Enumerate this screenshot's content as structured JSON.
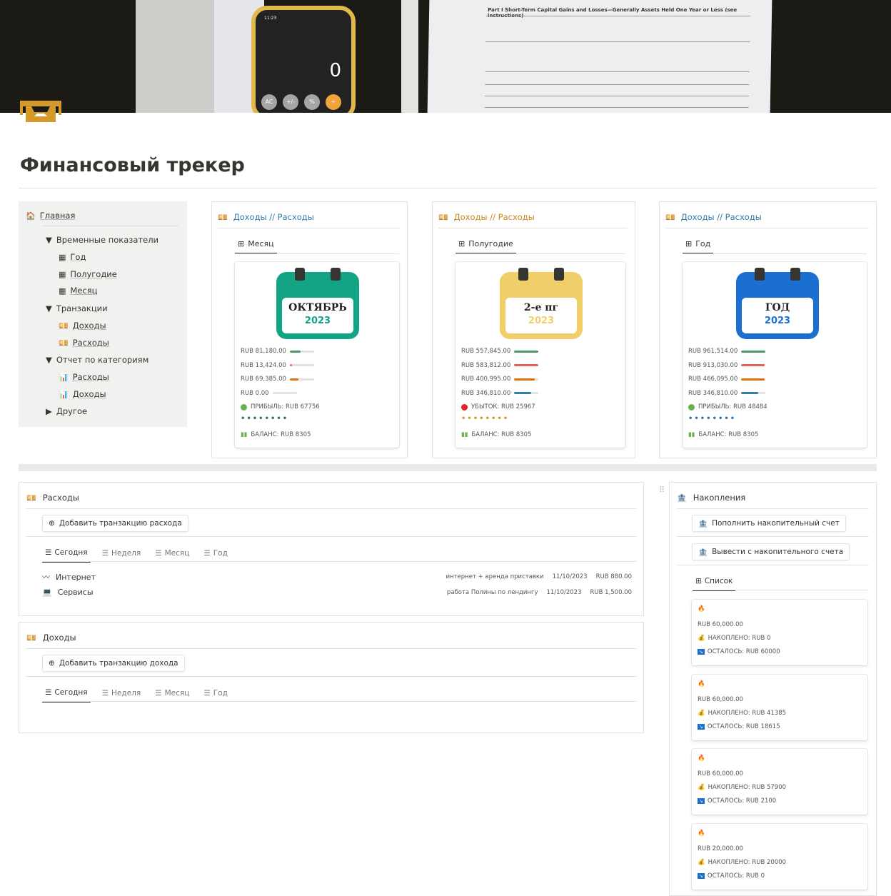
{
  "cover": {
    "form_title": "Part I  Short-Term Capital Gains and Losses—Generally Assets Held One Year or Less (see instructions)",
    "phone_time": "11:23",
    "phone_display": "0",
    "calc_keys": [
      "AC",
      "+/-",
      "%",
      "÷"
    ]
  },
  "page": {
    "title": "Финансовый трекер"
  },
  "sidebar": {
    "home": "Главная",
    "groups": [
      {
        "label": "Временные показатели",
        "expanded": true,
        "items": [
          "Год",
          "Полугодие",
          "Месяц"
        ]
      },
      {
        "label": "Транзакции",
        "expanded": true,
        "items": [
          "Доходы",
          "Расходы"
        ]
      },
      {
        "label": "Отчет по категориям",
        "expanded": true,
        "items": [
          "Расходы",
          "Доходы"
        ]
      },
      {
        "label": "Другое",
        "expanded": false,
        "items": []
      }
    ]
  },
  "cards": [
    {
      "header": "Доходы // Расходы",
      "tab": "Месяц",
      "cal_color": "#13a385",
      "cal_title": "ОКТЯБРЬ",
      "cal_year": "2023",
      "stats": [
        {
          "value": "RUB 81,180.00",
          "fill": 0.45,
          "color": "#4f9768"
        },
        {
          "value": "RUB 13,424.00",
          "fill": 0.08,
          "color": "#e16259"
        },
        {
          "value": "RUB 69,385.00",
          "fill": 0.35,
          "color": "#d9730d"
        },
        {
          "value": "RUB 0.00",
          "fill": 0,
          "color": "#337ea9"
        }
      ],
      "result": "ПРИБЫЛЬ: RUB 67756",
      "result_color": "#6aaf50",
      "dots_color": "#2f6f6b",
      "balance": "БАЛАНС: RUB 8305"
    },
    {
      "header": "Доходы // Расходы",
      "tab": "Полугодие",
      "cal_color": "#f0cf6a",
      "cal_title": "2-е пг",
      "cal_year": "2023",
      "header_color": "#c98a1b",
      "stats": [
        {
          "value": "RUB 557,845.00",
          "fill": 1,
          "color": "#4f9768"
        },
        {
          "value": "RUB 583,812.00",
          "fill": 1,
          "color": "#e16259"
        },
        {
          "value": "RUB 400,995.00",
          "fill": 0.85,
          "color": "#d9730d"
        },
        {
          "value": "RUB 346,810.00",
          "fill": 0.7,
          "color": "#337ea9"
        }
      ],
      "result": "УБЫТОК: RUB 25967",
      "result_color": "#e0232e",
      "dots_color": "#d39a2a",
      "balance": "БАЛАНС: RUB 8305"
    },
    {
      "header": "Доходы // Расходы",
      "tab": "Год",
      "cal_color": "#1b6fd0",
      "cal_title": "ГОД",
      "cal_year": "2023",
      "header_color": "#337ea9",
      "stats": [
        {
          "value": "RUB 961,514.00",
          "fill": 1,
          "color": "#4f9768"
        },
        {
          "value": "RUB 913,030.00",
          "fill": 0.95,
          "color": "#e16259"
        },
        {
          "value": "RUB 466,095.00",
          "fill": 0.95,
          "color": "#d9730d"
        },
        {
          "value": "RUB 346,810.00",
          "fill": 0.7,
          "color": "#337ea9"
        }
      ],
      "result": "ПРИБЫЛЬ: RUB 48484",
      "result_color": "#6aaf50",
      "dots_color": "#2a72b5",
      "balance": "БАЛАНС: RUB 8305"
    }
  ],
  "expenses": {
    "title": "Расходы",
    "add_button": "Добавить транзакцию расхода",
    "tabs": [
      "Сегодня",
      "Неделя",
      "Месяц",
      "Год"
    ],
    "items": [
      {
        "name": "Интернет",
        "icon": "wave-icon",
        "note": "интернет + аренда приставки",
        "date": "11/10/2023",
        "amount": "RUB 880.00"
      },
      {
        "name": "Сервисы",
        "icon": "laptop-icon",
        "note": "работа Полины по лендингу",
        "date": "11/10/2023",
        "amount": "RUB 1,500.00"
      }
    ]
  },
  "income": {
    "title": "Доходы",
    "add_button": "Добавить транзакцию дохода",
    "tabs": [
      "Сегодня",
      "Неделя",
      "Месяц",
      "Год"
    ]
  },
  "savings": {
    "title": "Накопления",
    "deposit_button": "Пополнить накопительный счет",
    "withdraw_button": "Вывести с накопительного счета",
    "tab": "Список",
    "items": [
      {
        "goal": "RUB 60,000.00",
        "saved": "НАКОПЛЕНО: RUB 0",
        "left": "ОСТАЛОСЬ: RUB 60000"
      },
      {
        "goal": "RUB 60,000.00",
        "saved": "НАКОПЛЕНО: RUB 41385",
        "left": "ОСТАЛОСЬ: RUB 18615"
      },
      {
        "goal": "RUB 60,000.00",
        "saved": "НАКОПЛЕНО: RUB 57900",
        "left": "ОСТАЛОСЬ: RUB 2100"
      },
      {
        "goal": "RUB 20,000.00",
        "saved": "НАКОПЛЕНО: RUB 20000",
        "left": "ОСТАЛОСЬ: RUB 0"
      }
    ]
  },
  "colors": {
    "accent": "#d39a2a",
    "sidebar_bg": "#f1f1ef"
  }
}
